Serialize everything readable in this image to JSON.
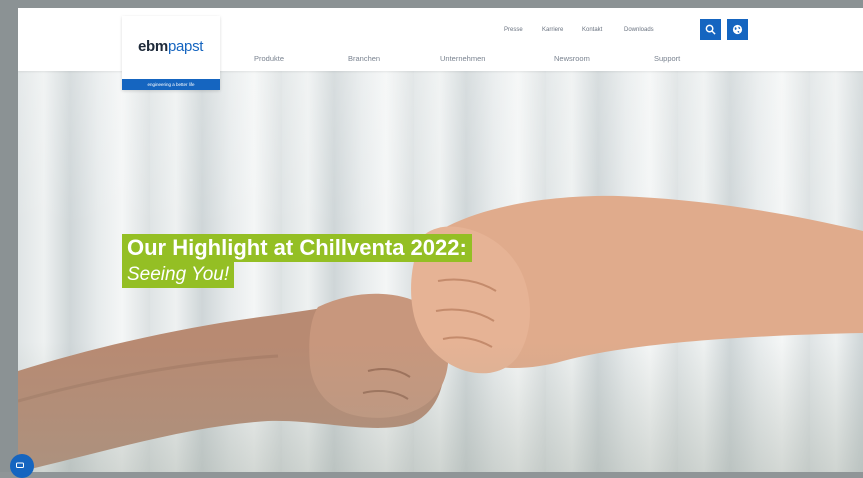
{
  "brand": {
    "logo_part1": "ebm",
    "logo_part2": "papst",
    "tagline": "engineering a better life"
  },
  "top_links": [
    "Presse",
    "Karriere",
    "Kontakt",
    "Downloads"
  ],
  "icons": {
    "search": "search-icon",
    "language": "globe-icon"
  },
  "main_nav": [
    "Produkte",
    "Branchen",
    "Unternehmen",
    "Newsroom",
    "Support"
  ],
  "hero": {
    "headline_line1": "Our Highlight at Chillventa 2022:",
    "headline_line2": "Seeing You!"
  },
  "colors": {
    "brand_blue": "#1565c0",
    "highlight_green": "#94bf24"
  }
}
